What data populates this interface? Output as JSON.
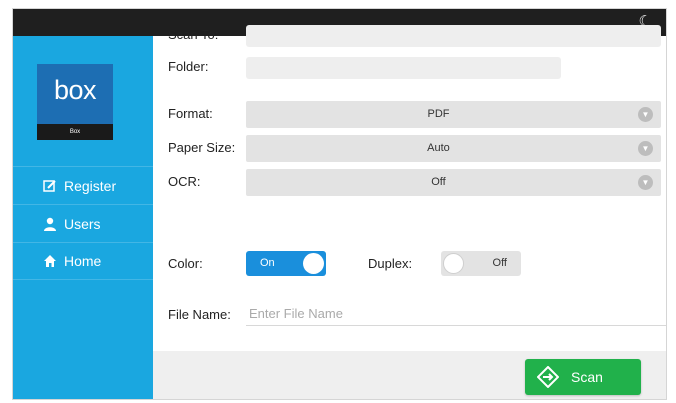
{
  "topbar": {
    "moon_icon": "moon-icon"
  },
  "sidebar": {
    "logo": {
      "text": "box",
      "subtext": "Box"
    },
    "items": [
      {
        "label": "Register",
        "icon": "edit-icon"
      },
      {
        "label": "Users",
        "icon": "user-icon"
      },
      {
        "label": "Home",
        "icon": "home-icon"
      }
    ]
  },
  "form": {
    "scan_to": {
      "label": "Scan To:",
      "value": ""
    },
    "folder": {
      "label": "Folder:",
      "value": ""
    },
    "format": {
      "label": "Format:",
      "value": "PDF"
    },
    "paper_size": {
      "label": "Paper Size:",
      "value": "Auto"
    },
    "ocr": {
      "label": "OCR:",
      "value": "Off"
    },
    "color": {
      "label": "Color:",
      "state": "On"
    },
    "duplex": {
      "label": "Duplex:",
      "state": "Off"
    },
    "file_name": {
      "label": "File Name:",
      "placeholder": "Enter File Name",
      "value": ""
    }
  },
  "actions": {
    "scan_label": "Scan"
  },
  "colors": {
    "sidebar": "#1aa7e0",
    "logo_bg": "#1d6eb3",
    "toggle_on": "#1a8fdc",
    "scan_button": "#21b14b",
    "topbar": "#1f1f1f"
  }
}
